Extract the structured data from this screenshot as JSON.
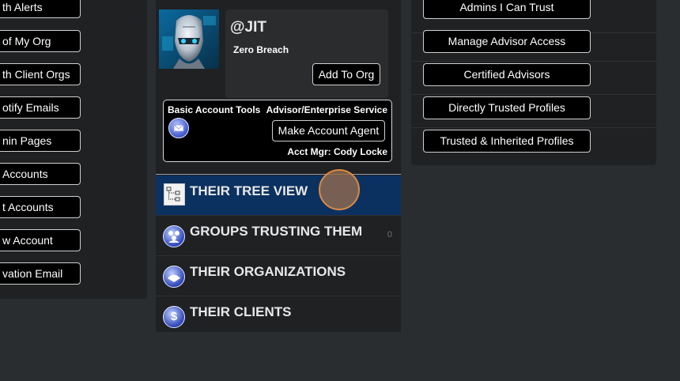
{
  "left_panel": {
    "buttons": [
      "th Alerts",
      " of My Org",
      "th Client Orgs",
      "otify Emails",
      "nin Pages",
      " Accounts",
      "t Accounts",
      "w Account",
      "vation Email"
    ]
  },
  "profile": {
    "handle": "@JIT",
    "org_name": "Zero Breach",
    "add_to_org_label": "Add To Org",
    "basic_tools_label": "Basic Account Tools",
    "service_label": "Advisor/Enterprise Service",
    "make_agent_label": "Make Account Agent",
    "acct_mgr": "Acct Mgr: Cody Locke"
  },
  "menu": {
    "tree_view": "THEIR TREE VIEW",
    "groups_trusting": "GROUPS TRUSTING THEM",
    "groups_count": "0",
    "organizations": "THEIR ORGANIZATIONS",
    "clients": "THEIR CLIENTS",
    "active_color": "#0b3161"
  },
  "right_panel": {
    "buttons": [
      "Admins I Can Trust",
      "Manage Advisor Access",
      "Certified Advisors",
      "Directly Trusted Profiles",
      "Trusted & Inherited Profiles"
    ]
  }
}
